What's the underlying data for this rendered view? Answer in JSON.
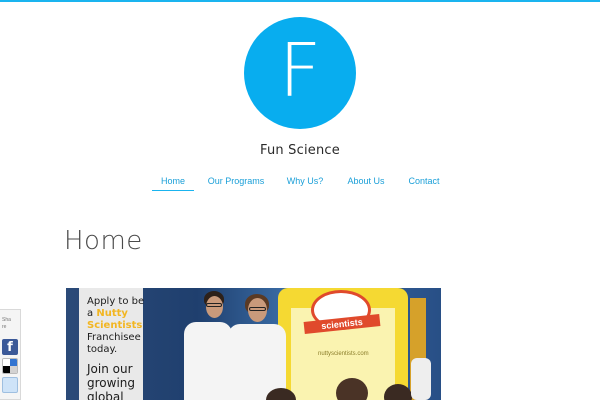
{
  "brand": {
    "logo_letter": "F",
    "site_title": "Fun Science",
    "accent_color": "#08adef"
  },
  "nav": {
    "items": [
      {
        "label": "Home",
        "active": true
      },
      {
        "label": "Our Programs",
        "active": false
      },
      {
        "label": "Why Us?",
        "active": false
      },
      {
        "label": "About Us",
        "active": false
      },
      {
        "label": "Contact",
        "active": false
      }
    ]
  },
  "page": {
    "heading": "Home"
  },
  "hero": {
    "promo_lines": [
      "Apply to be",
      "a",
      "Nutty",
      "Scientists",
      "Franchisee",
      "today.",
      "Join our",
      "growing",
      "global"
    ],
    "banner_text": "scientists",
    "banner_url": "nuttyscientists.com"
  },
  "share": {
    "label": "Share",
    "icons": [
      "facebook-icon",
      "delicious-icon",
      "reddit-icon"
    ]
  }
}
